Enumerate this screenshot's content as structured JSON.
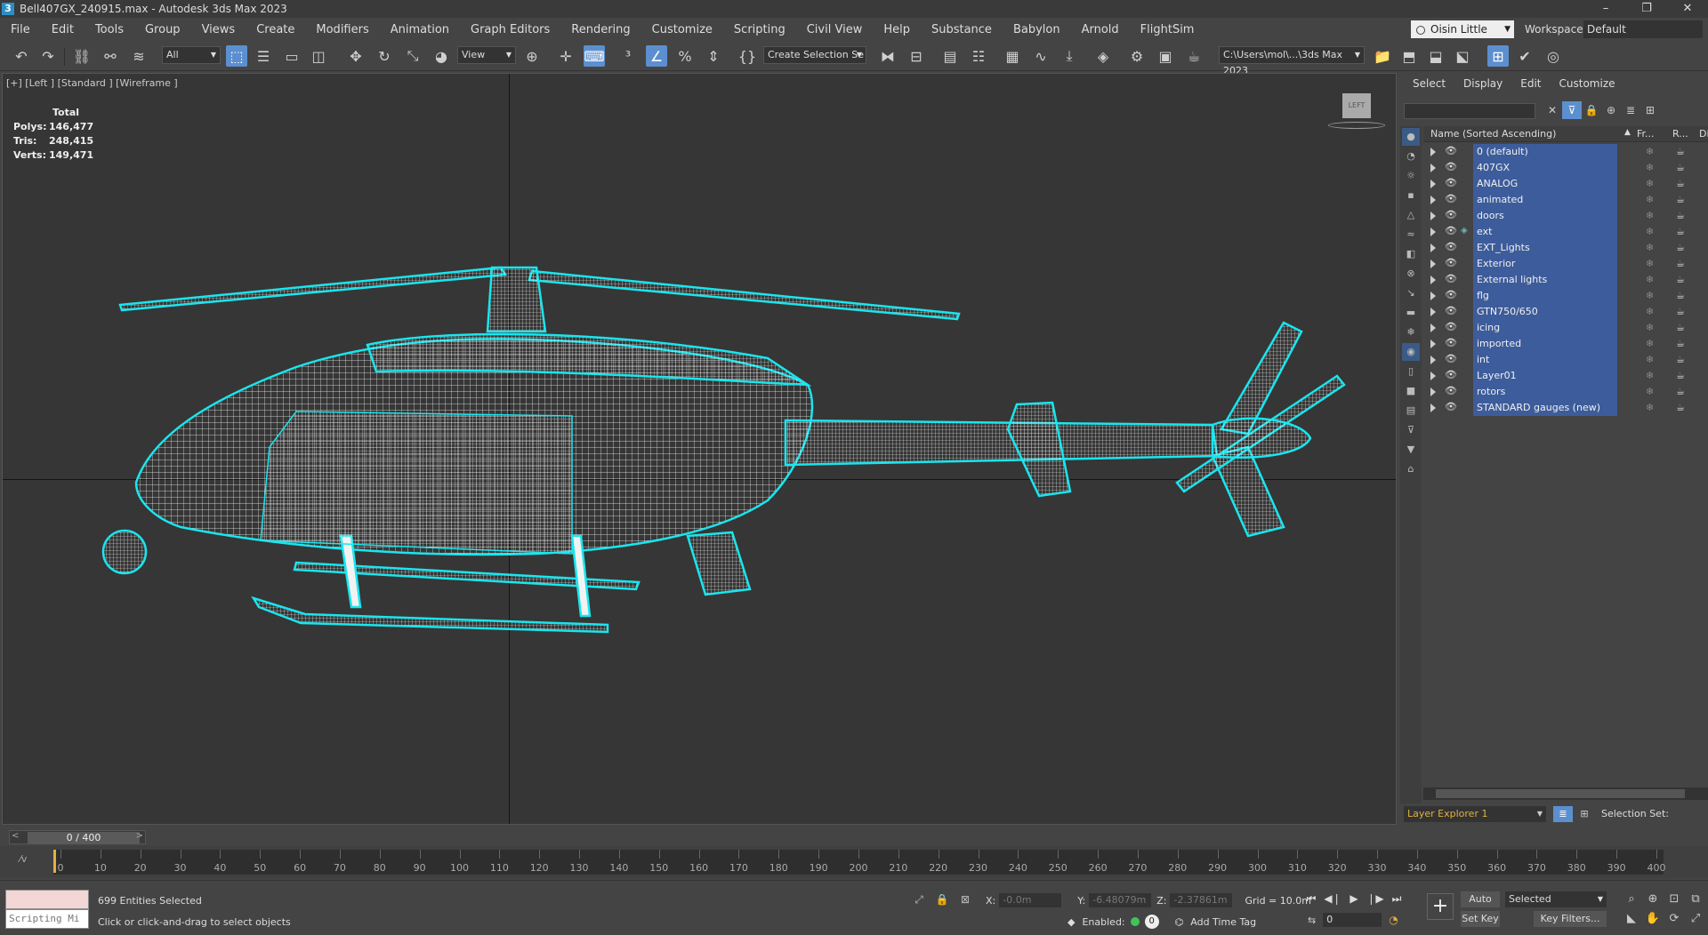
{
  "window": {
    "title": "Bell407GX_240915.max - Autodesk 3ds Max 2023",
    "controls": [
      "–",
      "❐",
      "✕"
    ]
  },
  "menu": {
    "items": [
      "File",
      "Edit",
      "Tools",
      "Group",
      "Views",
      "Create",
      "Modifiers",
      "Animation",
      "Graph Editors",
      "Rendering",
      "Customize",
      "Scripting",
      "Civil View",
      "Help",
      "Substance",
      "Babylon",
      "Arnold",
      "FlightSim"
    ],
    "user": "Oisin Little",
    "workspaces_label": "Workspaces:",
    "workspace_value": "Default"
  },
  "toolbar": {
    "selection_filter": "All",
    "ref_coord": "View",
    "named_selection": "Create Selection Se",
    "project_path": "C:\\Users\\mol\\...\\3ds Max 2023"
  },
  "viewport": {
    "label": "[+] [Left ] [Standard ] [Wireframe ]",
    "stats": {
      "header": "Total",
      "polys_label": "Polys:",
      "polys": "146,477",
      "tris_label": "Tris:",
      "tris": "248,415",
      "verts_label": "Verts:",
      "verts": "149,471"
    },
    "viewcube_label": "LEFT",
    "wire_color": "#19e6ee"
  },
  "explorer": {
    "tabs": [
      "Select",
      "Display",
      "Edit",
      "Customize"
    ],
    "columns": {
      "name": "Name (Sorted Ascending)",
      "frozen": "Fr...",
      "render": "R...",
      "display": "Display"
    },
    "layers": [
      {
        "name": "0 (default)"
      },
      {
        "name": "407GX"
      },
      {
        "name": "ANALOG"
      },
      {
        "name": "animated"
      },
      {
        "name": "doors"
      },
      {
        "name": "ext"
      },
      {
        "name": "EXT_Lights"
      },
      {
        "name": "Exterior"
      },
      {
        "name": "External lights"
      },
      {
        "name": "flg"
      },
      {
        "name": "GTN750/650"
      },
      {
        "name": "icing"
      },
      {
        "name": "imported"
      },
      {
        "name": "int"
      },
      {
        "name": "Layer01"
      },
      {
        "name": "rotors"
      },
      {
        "name": "STANDARD gauges (new)"
      }
    ],
    "selection_color": "#3d5c9b",
    "explorer_name": "Layer Explorer 1",
    "selection_set_label": "Selection Set:"
  },
  "timeline": {
    "slider_text": "0 / 400",
    "prev": "<",
    "next": ">",
    "ticks": [
      "0",
      "10",
      "20",
      "30",
      "40",
      "50",
      "60",
      "70",
      "80",
      "90",
      "100",
      "110",
      "120",
      "130",
      "140",
      "150",
      "160",
      "170",
      "180",
      "190",
      "200",
      "210",
      "220",
      "230",
      "240",
      "250",
      "260",
      "270",
      "280",
      "290",
      "300",
      "310",
      "320",
      "330",
      "340",
      "350",
      "360",
      "370",
      "380",
      "390",
      "400"
    ]
  },
  "status": {
    "maxscript_placeholder": "Scripting Mi",
    "entities_selected": "699 Entities Selected",
    "prompt": "Click or click-and-drag to select objects",
    "x_label": "X:",
    "x_value": "-0.0m",
    "y_label": "Y:",
    "y_value": "-6.48079m",
    "z_label": "Z:",
    "z_value": "-2.37861m",
    "grid": "Grid = 10.0m",
    "enabled_label": "Enabled:",
    "enabled_value": "0",
    "add_time_tag": "Add Time Tag",
    "auto_key": "Auto Key",
    "set_key": "Set Key",
    "selected_dd": "Selected",
    "key_filters": "Key Filters...",
    "frame": "0"
  }
}
